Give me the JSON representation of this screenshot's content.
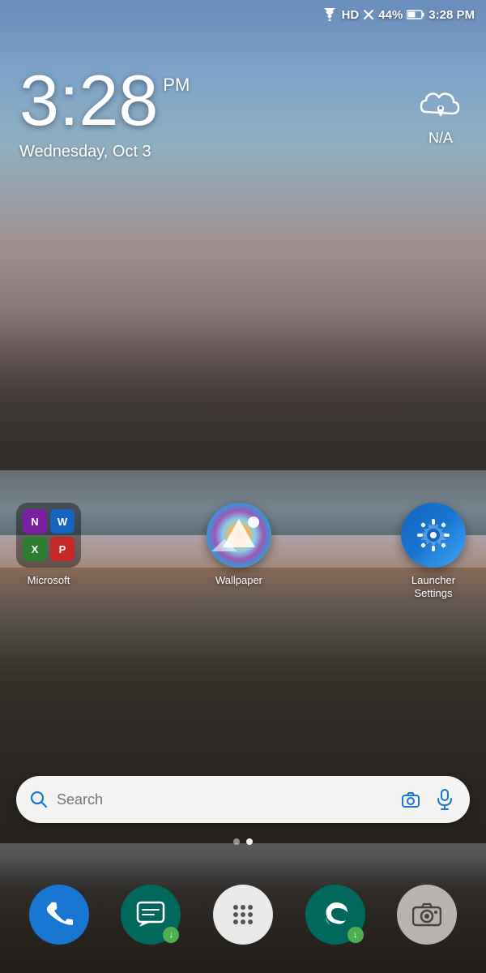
{
  "statusBar": {
    "time": "3:28 PM",
    "battery": "44%",
    "hdLabel": "HD"
  },
  "clock": {
    "hour": "3:28",
    "ampm": "PM",
    "date": "Wednesday, Oct 3"
  },
  "weather": {
    "label": "N/A"
  },
  "apps": [
    {
      "id": "microsoft",
      "label": "Microsoft",
      "type": "folder"
    },
    {
      "id": "wallpaper",
      "label": "Wallpaper",
      "type": "wallpaper"
    },
    {
      "id": "launcher",
      "label": "Launcher Settings",
      "type": "launcher"
    }
  ],
  "searchBar": {
    "placeholder": "Search"
  },
  "pageDots": {
    "count": 2,
    "active": 1
  },
  "dock": [
    {
      "id": "phone",
      "label": "Phone",
      "type": "phone"
    },
    {
      "id": "messages",
      "label": "Messages",
      "type": "messages",
      "badge": true
    },
    {
      "id": "apps-drawer",
      "label": "All Apps",
      "type": "apps"
    },
    {
      "id": "edge",
      "label": "Edge",
      "type": "edge",
      "badge": true
    },
    {
      "id": "camera",
      "label": "Camera",
      "type": "camera"
    }
  ]
}
